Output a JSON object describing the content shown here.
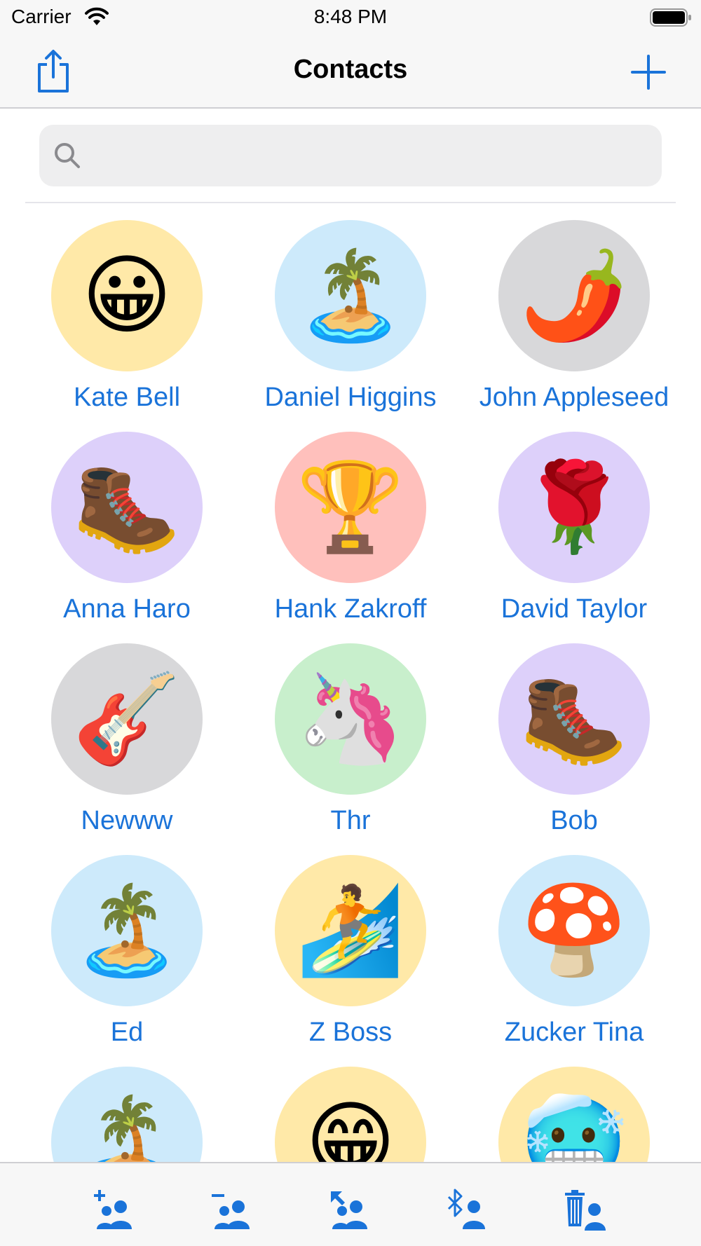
{
  "status_bar": {
    "carrier": "Carrier",
    "time": "8:48 PM"
  },
  "nav": {
    "title": "Contacts",
    "share_icon": "share-icon",
    "add_icon": "plus-icon"
  },
  "search": {
    "placeholder": "",
    "value": ""
  },
  "colors": {
    "accent": "#1a73d9",
    "yellow": "#ffe9a8",
    "blue": "#cdeafb",
    "gray": "#d8d8da",
    "purple": "#ddd0fa",
    "red": "#ffc0bc",
    "green": "#c8efcc"
  },
  "contacts": [
    {
      "name": "Kate Bell",
      "emoji": "😀",
      "icon": "grinning-face-icon",
      "bg": "#ffe9a8"
    },
    {
      "name": "Daniel Higgins",
      "emoji": "🏝️",
      "icon": "beach-umbrella-island-icon",
      "bg": "#cdeafb"
    },
    {
      "name": "John Appleseed",
      "emoji": "🌶️",
      "icon": "hot-pepper-icon",
      "bg": "#d8d8da"
    },
    {
      "name": "Anna Haro",
      "emoji": "🥾",
      "icon": "hiking-boot-icon",
      "bg": "#ddd0fa"
    },
    {
      "name": "Hank Zakroff",
      "emoji": "🏆",
      "icon": "trophy-icon",
      "bg": "#ffc0bc"
    },
    {
      "name": "David Taylor",
      "emoji": "🌹",
      "icon": "rose-icon",
      "bg": "#ddd0fa"
    },
    {
      "name": "Newww",
      "emoji": "🎸",
      "icon": "guitar-icon",
      "bg": "#d8d8da"
    },
    {
      "name": "Thr",
      "emoji": "🦄",
      "icon": "unicorn-icon",
      "bg": "#c8efcc"
    },
    {
      "name": "Bob",
      "emoji": "🥾",
      "icon": "hiking-boot-icon",
      "bg": "#ddd0fa"
    },
    {
      "name": "Ed",
      "emoji": "🏝️",
      "icon": "beach-umbrella-island-icon",
      "bg": "#cdeafb"
    },
    {
      "name": "Z Boss",
      "emoji": "🏄",
      "icon": "surfer-icon",
      "bg": "#ffe9a8"
    },
    {
      "name": "Zucker Tina",
      "emoji": "🍄",
      "icon": "mushroom-icon",
      "bg": "#cdeafb"
    },
    {
      "name": "",
      "emoji": "🏝️",
      "icon": "beach-umbrella-island-icon",
      "bg": "#cdeafb"
    },
    {
      "name": "",
      "emoji": "😁",
      "icon": "grinning-face-icon",
      "bg": "#ffe9a8"
    },
    {
      "name": "",
      "emoji": "🥶",
      "icon": "cold-face-icon",
      "bg": "#ffe9a8"
    }
  ],
  "toolbar": [
    {
      "icon": "add-contact-icon"
    },
    {
      "icon": "remove-contact-icon"
    },
    {
      "icon": "share-contact-icon"
    },
    {
      "icon": "bluetooth-contact-icon"
    },
    {
      "icon": "delete-contact-icon"
    }
  ]
}
